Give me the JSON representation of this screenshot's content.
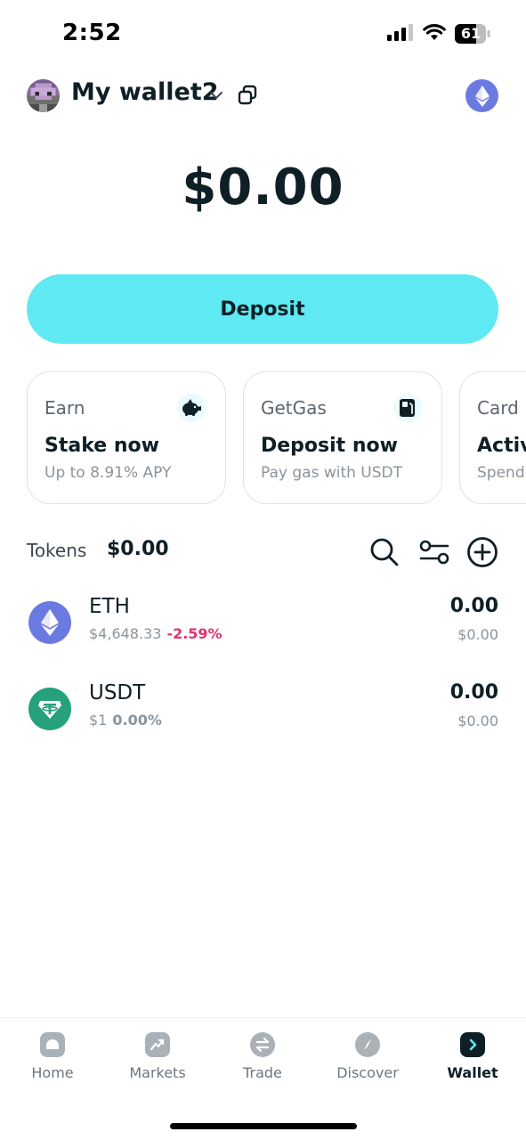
{
  "status_bar": {
    "time": "2:52",
    "battery": "61"
  },
  "header": {
    "wallet_name": "My wallet2",
    "avatar_icon": "pixel-avatar-icon",
    "network_icon": "ethereum-icon",
    "copy_icon": "copy-icon",
    "chevron_icon": "chevron-down-icon"
  },
  "balance": {
    "total": "$0.00"
  },
  "deposit_button": {
    "label": "Deposit",
    "color": "#5ee9f3"
  },
  "cards": [
    {
      "category": "Earn",
      "title": "Stake now",
      "subtitle": "Up to 8.91% APY",
      "icon": "piggy-bank-icon"
    },
    {
      "category": "GetGas",
      "title": "Deposit now",
      "subtitle": "Pay gas with USDT",
      "icon": "gas-pump-icon"
    },
    {
      "category": "Card",
      "title": "Activ",
      "subtitle": "Spend"
    }
  ],
  "tokens": {
    "label": "Tokens",
    "total": "$0.00",
    "items": [
      {
        "symbol": "ETH",
        "price": "$4,648.33",
        "change": "-2.59%",
        "change_color": "#e0336b",
        "amount": "0.00",
        "fiat": "$0.00",
        "icon": "ethereum-icon",
        "icon_color": "#6b7ae0"
      },
      {
        "symbol": "USDT",
        "price": "$1",
        "change": "0.00%",
        "change_color": "#8a949c",
        "amount": "0.00",
        "fiat": "$0.00",
        "icon": "tether-icon",
        "icon_color": "#26a17b"
      }
    ]
  },
  "bottom_nav": {
    "items": [
      {
        "label": "Home",
        "icon": "home-icon"
      },
      {
        "label": "Markets",
        "icon": "markets-icon"
      },
      {
        "label": "Trade",
        "icon": "trade-icon"
      },
      {
        "label": "Discover",
        "icon": "discover-icon"
      },
      {
        "label": "Wallet",
        "icon": "wallet-icon",
        "active": true
      }
    ]
  }
}
